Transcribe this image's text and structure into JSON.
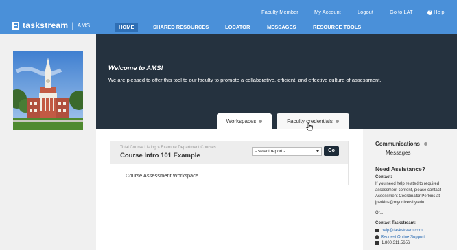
{
  "header": {
    "util_links": [
      "Faculty Member",
      "My Account",
      "Logout",
      "Go to LAT",
      "Help"
    ],
    "logo_text": "taskstream",
    "logo_sep": "|",
    "logo_sub": "AMS",
    "nav": [
      "HOME",
      "SHARED RESOURCES",
      "LOCATOR",
      "MESSAGES",
      "RESOURCE TOOLS"
    ],
    "active_nav": "HOME"
  },
  "banner": {
    "title": "Welcome to AMS!",
    "text": "We are pleased to offer this tool to our faculty to promote a collaborative, efficient, and effective culture of assessment.",
    "tabs": [
      "Workspaces",
      "Faculty credentials"
    ],
    "active_tab": "Workspaces"
  },
  "main": {
    "breadcrumb": "Total Course Listing » Example Department Courses",
    "course_title": "Course Intro 101 Example",
    "report_select_value": "- select report -",
    "go_label": "Go",
    "workspace_item": "Course Assessment Workspace"
  },
  "sidebar": {
    "communications_title": "Communications",
    "messages": "Messages",
    "need_assistance": "Need Assistance?",
    "contact_label": "Contact:",
    "contact_lines": [
      "If you need help related to required",
      "assessment content, please contact",
      "Assessment Coordinator Perkins at",
      "jperkins@myuniversity.edu."
    ],
    "or": "Or...",
    "contact_taskstream": "Contact Taskstream:",
    "email": "help@taskstream.com",
    "support": "Request Online Support",
    "phone": "1.800.311.5656"
  },
  "colors": {
    "header_blue": "#4a90d9",
    "banner_dark": "#25323f",
    "go_button": "#1d2b38",
    "link_blue": "#2f6fb5"
  }
}
